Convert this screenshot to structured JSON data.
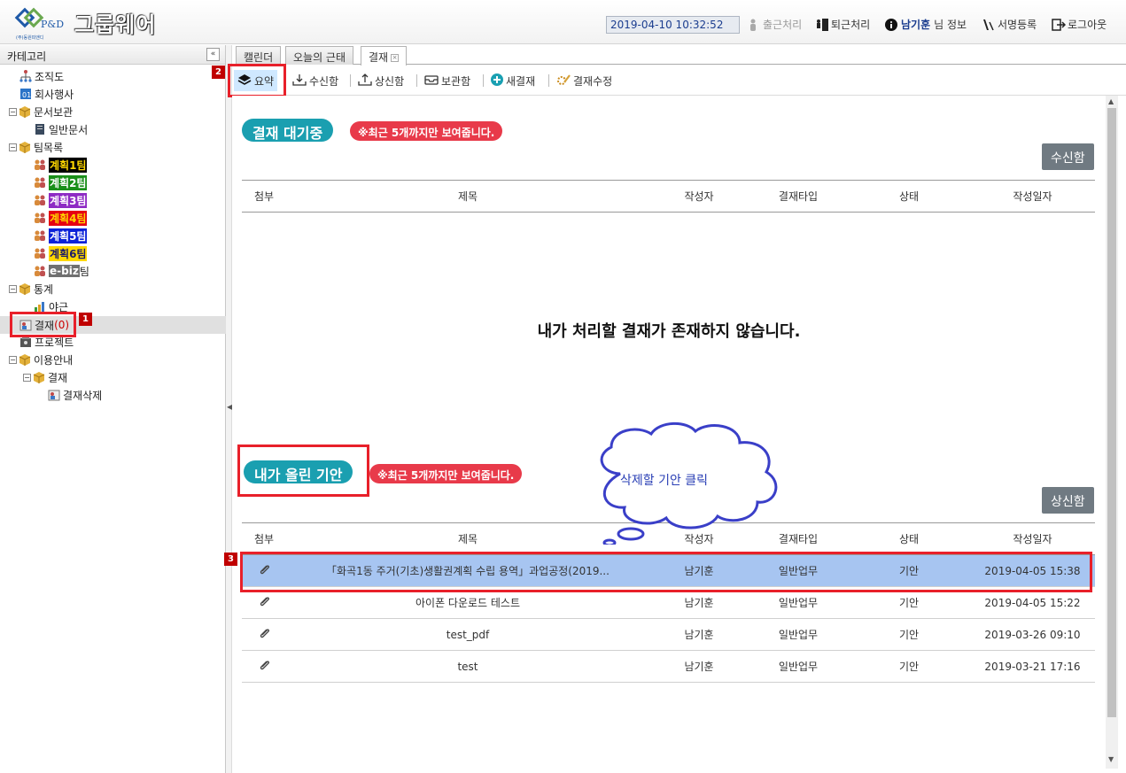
{
  "header": {
    "brand": "그룹웨어",
    "logo_text": "P&D",
    "logo_sub": "(주)동원피앤디",
    "datetime": "2019-04-10 10:32:52",
    "checkin": "출근처리",
    "checkout": "퇴근처리",
    "user_name": "남기훈",
    "user_info_suffix": "님 정보",
    "signature": "서명등록",
    "logout": "로그아웃"
  },
  "sidebar": {
    "title": "카테고리",
    "collapse": "«",
    "items": {
      "org": "조직도",
      "events": "회사행사",
      "docs": "문서보관",
      "general_docs": "일반문서",
      "teams": "팀목록",
      "team1": "계획1팀",
      "team2": "계획2팀",
      "team3": "계획3팀",
      "team4": "계획4팀",
      "team5": "계획5팀",
      "team6": "계획6팀",
      "ebiz": "e-biz",
      "ebiz_suffix": "팀",
      "stats": "통계",
      "overtime": "야근",
      "approval": "결재",
      "approval_count": "(0)",
      "project": "프로젝트",
      "guide": "이용안내",
      "guide_approval": "결재",
      "guide_delete": "결재삭제"
    },
    "team_colors": {
      "team1": [
        "#000000",
        "#ffd800"
      ],
      "team2": [
        "#1a8f1a",
        "#ffffff"
      ],
      "team3": [
        "#8e2bc4",
        "#ffffff"
      ],
      "team4": [
        "#e60012",
        "#ffd800"
      ],
      "team5": [
        "#0b22d8",
        "#ffffff"
      ],
      "team6": [
        "#ffd800",
        "#1a1a6a"
      ],
      "ebiz": [
        "#707070",
        "#ffffff"
      ]
    }
  },
  "tabs": [
    {
      "label": "캘린더"
    },
    {
      "label": "오늘의 근태"
    },
    {
      "label": "결재",
      "closable": true
    }
  ],
  "toolbar": {
    "summary": "요약",
    "inbox": "수신함",
    "outbox": "상신함",
    "archive": "보관함",
    "new": "새결재",
    "edit": "결재수정"
  },
  "pending": {
    "title": "결재 대기중",
    "note": "※최근 5개까지만 보여줍니다.",
    "button": "수신함",
    "columns": [
      "첨부",
      "제목",
      "작성자",
      "결재타입",
      "상태",
      "작성일자"
    ],
    "empty_message": "내가 처리할 결재가 존재하지 않습니다."
  },
  "mine": {
    "title": "내가 올린 기안",
    "note": "※최근 5개까지만 보여줍니다.",
    "button": "상신함",
    "columns": [
      "첨부",
      "제목",
      "작성자",
      "결재타입",
      "상태",
      "작성일자"
    ],
    "rows": [
      {
        "title": "「화곡1동 주거(기초)생활권계획 수립 용역」과업공정(2019...",
        "author": "남기훈",
        "type": "일반업무",
        "status": "기안",
        "date": "2019-04-05 15:38"
      },
      {
        "title": "아이폰 다운로드 테스트",
        "author": "남기훈",
        "type": "일반업무",
        "status": "기안",
        "date": "2019-04-05 15:22"
      },
      {
        "title": "test_pdf",
        "author": "남기훈",
        "type": "일반업무",
        "status": "기안",
        "date": "2019-03-26 09:10"
      },
      {
        "title": "test",
        "author": "남기훈",
        "type": "일반업무",
        "status": "기안",
        "date": "2019-03-21 17:16"
      }
    ]
  },
  "annotations": {
    "step1": "1",
    "step2": "2",
    "step3": "3",
    "callout": "삭제할 기안 클릭"
  }
}
